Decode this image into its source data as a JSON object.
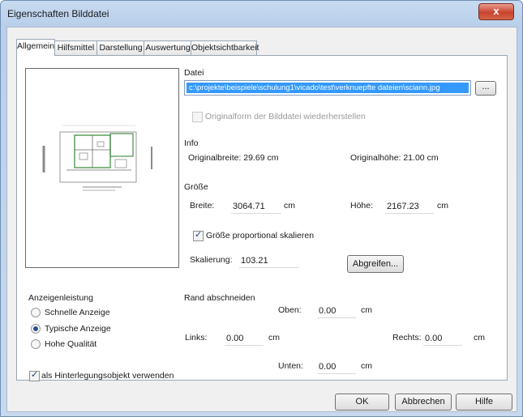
{
  "window": {
    "title": "Eigenschaften Bilddatei",
    "close_label": "x"
  },
  "tabs": [
    "Allgemein",
    "Hilfsmittel",
    "Darstellung",
    "Auswertung",
    "Objektsichtbarkeit"
  ],
  "file": {
    "group_label": "Datei",
    "path_value": "c:\\projekte\\beispiele\\schulung1\\vicado\\test\\verknuepfte dateien\\sciann.jpg",
    "browse_label": "...",
    "restore_label": "Originalform der Bilddatei wiederherstellen"
  },
  "info": {
    "group_label": "Info",
    "width_text": "Originalbreite: 29.69 cm",
    "height_text": "Originalhöhe:  21.00 cm"
  },
  "size": {
    "group_label": "Größe",
    "width_label": "Breite:",
    "width_value": "3064.71",
    "width_unit": "cm",
    "height_label": "Höhe:",
    "height_value": "2167.23",
    "height_unit": "cm",
    "proportional_label": "Größe proportional skalieren",
    "scale_label": "Skalierung:",
    "scale_value": "103.21",
    "pick_label": "Abgreifen..."
  },
  "display": {
    "group_label": "Anzeigenleistung",
    "options": [
      "Schnelle Anzeige",
      "Typische Anzeige",
      "Hohe Qualität"
    ],
    "selected": "Typische Anzeige"
  },
  "crop": {
    "group_label": "Rand abschneiden",
    "top_label": "Oben:",
    "top_value": "0.00",
    "top_unit": "cm",
    "left_label": "Links:",
    "left_value": "0.00",
    "left_unit": "cm",
    "right_label": "Rechts:",
    "right_value": "0.00",
    "right_unit": "cm",
    "bottom_label": "Unten:",
    "bottom_value": "0.00",
    "bottom_unit": "cm"
  },
  "background_object_label": "als Hinterlegungsobjekt verwenden",
  "buttons": {
    "ok": "OK",
    "cancel": "Abbrechen",
    "help": "Hilfe"
  }
}
